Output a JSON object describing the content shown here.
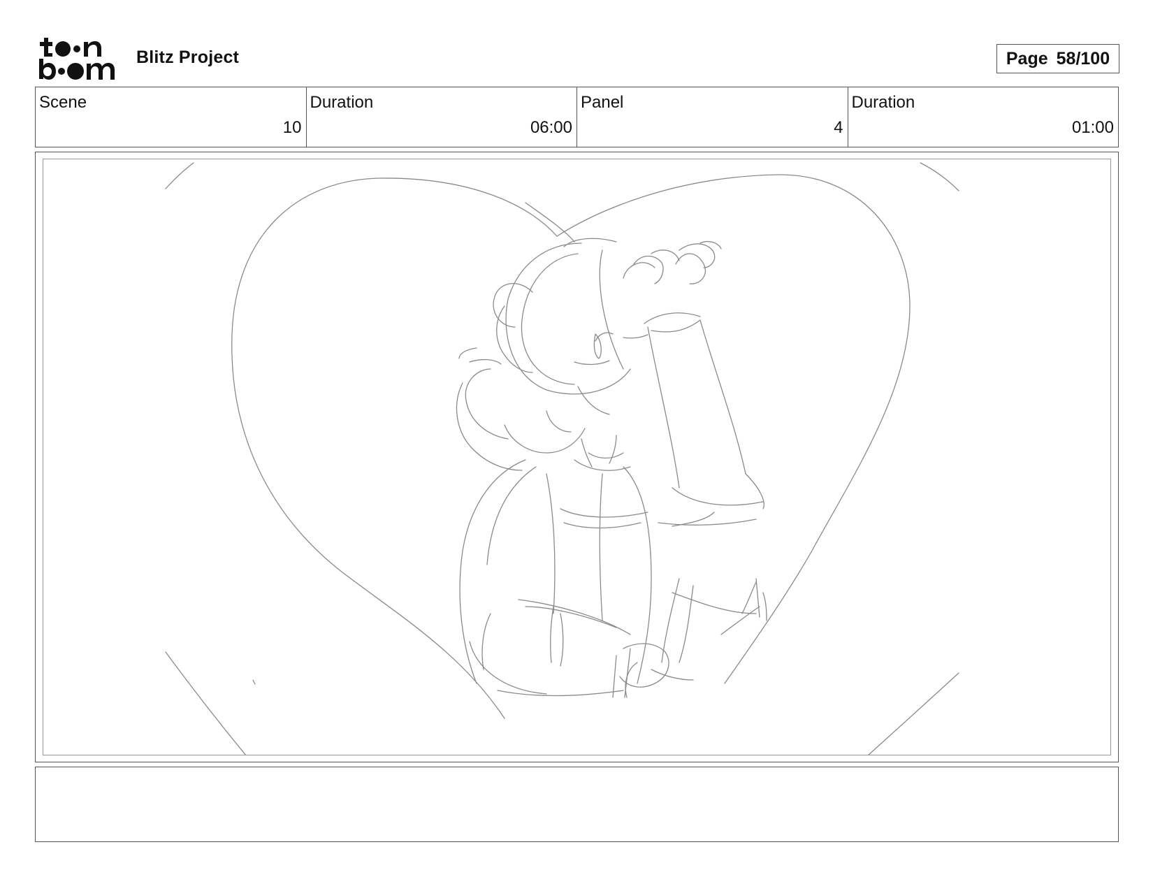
{
  "header": {
    "logo_icon": "toonboom-logo-icon",
    "project_title": "Blitz Project",
    "page_label": "Page",
    "page_value": "58/100"
  },
  "info": {
    "scene": {
      "label": "Scene",
      "value": "10"
    },
    "scene_duration": {
      "label": "Duration",
      "value": "06:00"
    },
    "panel": {
      "label": "Panel",
      "value": "4"
    },
    "panel_duration": {
      "label": "Duration",
      "value": "01:00"
    }
  },
  "panel_image": {
    "icon": "storyboard-sketch-image"
  },
  "notes": {
    "text": ""
  },
  "colors": {
    "border": "#555555",
    "sketch_line": "#8a8a8a",
    "text": "#111111"
  }
}
